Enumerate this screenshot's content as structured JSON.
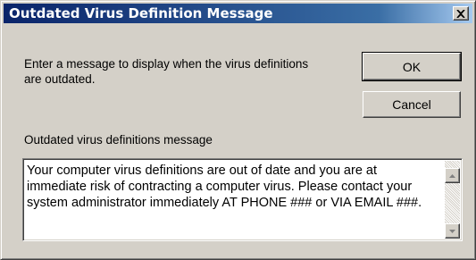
{
  "window": {
    "title": "Outdated Virus Definition Message"
  },
  "prompt": {
    "text": "Enter a message to display when the virus definitions are outdated."
  },
  "buttons": {
    "ok_label": "OK",
    "cancel_label": "Cancel"
  },
  "message_field": {
    "label": "Outdated virus definitions message",
    "value": "Your computer virus definitions are out of date and you are at immediate risk of contracting a computer virus. Please contact your system administrator immediately AT PHONE ### or VIA EMAIL ###."
  },
  "icons": {
    "close": "close-icon",
    "scroll_up": "arrow-up-icon",
    "scroll_down": "arrow-down-icon"
  },
  "colors": {
    "titlebar_start": "#0a246a",
    "titlebar_end": "#a6caf0",
    "face": "#d4d0c8"
  }
}
